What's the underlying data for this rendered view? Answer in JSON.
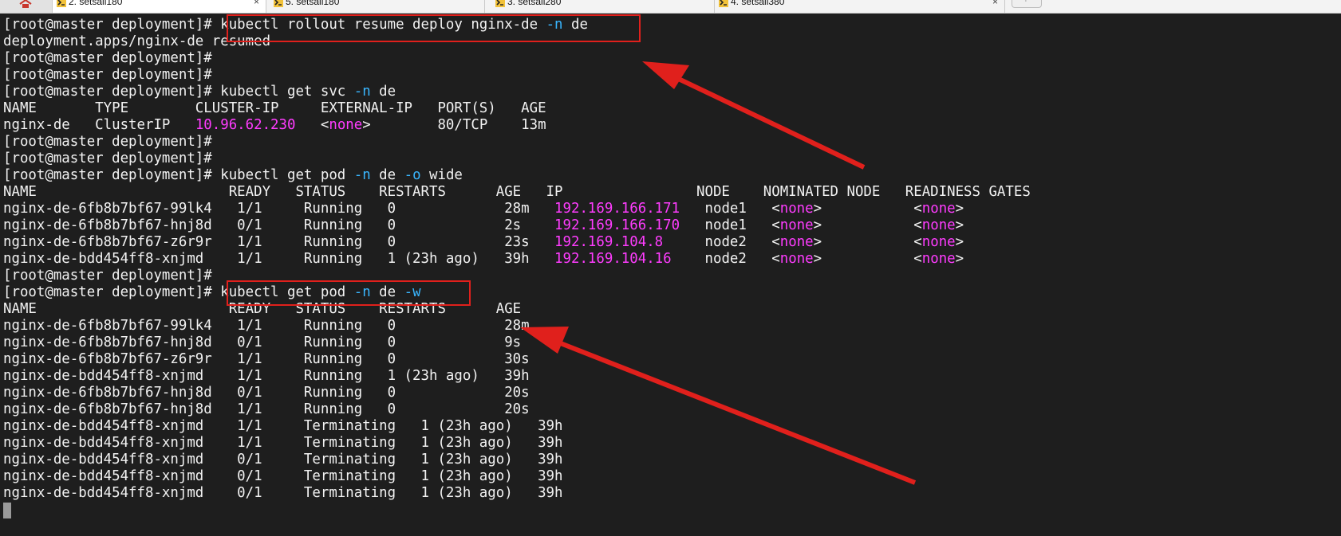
{
  "window": {
    "tabs": [
      {
        "label": "2. setsail180",
        "active": true,
        "has_close": true
      },
      {
        "label": "5. setsail180",
        "active": false,
        "has_close": false
      },
      {
        "label": "3. setsail280",
        "active": false,
        "has_close": false
      },
      {
        "label": "4. setsail380",
        "active": false,
        "has_close": true
      }
    ],
    "new_tab_glyph": "+",
    "close_glyph": "×"
  },
  "terminal": {
    "lines": [
      [
        {
          "t": "[root@master deployment]# kubectl rollout resume deploy nginx-de "
        },
        {
          "t": "-n",
          "c": "flag"
        },
        {
          "t": " de"
        }
      ],
      [
        {
          "t": "deployment.apps/nginx-de resumed"
        }
      ],
      [
        {
          "t": "[root@master deployment]#"
        }
      ],
      [
        {
          "t": "[root@master deployment]#"
        }
      ],
      [
        {
          "t": "[root@master deployment]# kubectl get svc "
        },
        {
          "t": "-n",
          "c": "flag"
        },
        {
          "t": " de"
        }
      ],
      [
        {
          "t": "NAME       TYPE        CLUSTER-IP     EXTERNAL-IP   PORT(S)   AGE"
        }
      ],
      [
        {
          "t": "nginx-de   ClusterIP   "
        },
        {
          "t": "10.96.62.230",
          "c": "ip"
        },
        {
          "t": "   <"
        },
        {
          "t": "none",
          "c": "none"
        },
        {
          "t": ">        80/TCP    13m"
        }
      ],
      [
        {
          "t": "[root@master deployment]#"
        }
      ],
      [
        {
          "t": "[root@master deployment]#"
        }
      ],
      [
        {
          "t": "[root@master deployment]# kubectl get pod "
        },
        {
          "t": "-n",
          "c": "flag"
        },
        {
          "t": " de "
        },
        {
          "t": "-o",
          "c": "flag"
        },
        {
          "t": " wide"
        }
      ],
      [
        {
          "t": "NAME                       READY   STATUS    RESTARTS      AGE   IP                NODE    NOMINATED NODE   READINESS GATES"
        }
      ],
      [
        {
          "t": "nginx-de-6fb8b7bf67-99lk4   1/1     Running   0             28m   "
        },
        {
          "t": "192.169.166.171",
          "c": "ip"
        },
        {
          "t": "   node1   <"
        },
        {
          "t": "none",
          "c": "none"
        },
        {
          "t": ">           <"
        },
        {
          "t": "none",
          "c": "none"
        },
        {
          "t": ">"
        }
      ],
      [
        {
          "t": "nginx-de-6fb8b7bf67-hnj8d   0/1     Running   0             2s    "
        },
        {
          "t": "192.169.166.170",
          "c": "ip"
        },
        {
          "t": "   node1   <"
        },
        {
          "t": "none",
          "c": "none"
        },
        {
          "t": ">           <"
        },
        {
          "t": "none",
          "c": "none"
        },
        {
          "t": ">"
        }
      ],
      [
        {
          "t": "nginx-de-6fb8b7bf67-z6r9r   1/1     Running   0             23s   "
        },
        {
          "t": "192.169.104.8",
          "c": "ip"
        },
        {
          "t": "     node2   <"
        },
        {
          "t": "none",
          "c": "none"
        },
        {
          "t": ">           <"
        },
        {
          "t": "none",
          "c": "none"
        },
        {
          "t": ">"
        }
      ],
      [
        {
          "t": "nginx-de-bdd454ff8-xnjmd    1/1     Running   1 (23h ago)   39h   "
        },
        {
          "t": "192.169.104.16",
          "c": "ip"
        },
        {
          "t": "    node2   <"
        },
        {
          "t": "none",
          "c": "none"
        },
        {
          "t": ">           <"
        },
        {
          "t": "none",
          "c": "none"
        },
        {
          "t": ">"
        }
      ],
      [
        {
          "t": "[root@master deployment]#"
        }
      ],
      [
        {
          "t": "[root@master deployment]# kubectl get pod "
        },
        {
          "t": "-n",
          "c": "flag"
        },
        {
          "t": " de "
        },
        {
          "t": "-w",
          "c": "flag"
        }
      ],
      [
        {
          "t": "NAME                       READY   STATUS    RESTARTS      AGE"
        }
      ],
      [
        {
          "t": "nginx-de-6fb8b7bf67-99lk4   1/1     Running   0             28m"
        }
      ],
      [
        {
          "t": "nginx-de-6fb8b7bf67-hnj8d   0/1     Running   0             9s"
        }
      ],
      [
        {
          "t": "nginx-de-6fb8b7bf67-z6r9r   1/1     Running   0             30s"
        }
      ],
      [
        {
          "t": "nginx-de-bdd454ff8-xnjmd    1/1     Running   1 (23h ago)   39h"
        }
      ],
      [
        {
          "t": "nginx-de-6fb8b7bf67-hnj8d   0/1     Running   0             20s"
        }
      ],
      [
        {
          "t": "nginx-de-6fb8b7bf67-hnj8d   1/1     Running   0             20s"
        }
      ],
      [
        {
          "t": "nginx-de-bdd454ff8-xnjmd    1/1     Terminating   1 (23h ago)   39h"
        }
      ],
      [
        {
          "t": "nginx-de-bdd454ff8-xnjmd    1/1     Terminating   1 (23h ago)   39h"
        }
      ],
      [
        {
          "t": "nginx-de-bdd454ff8-xnjmd    0/1     Terminating   1 (23h ago)   39h"
        }
      ],
      [
        {
          "t": "nginx-de-bdd454ff8-xnjmd    0/1     Terminating   1 (23h ago)   39h"
        }
      ],
      [
        {
          "t": "nginx-de-bdd454ff8-xnjmd    0/1     Terminating   1 (23h ago)   39h"
        }
      ]
    ],
    "colors": {
      "background": "#1e1e1e",
      "text": "#f2f2f2",
      "ip": "#ff3cff",
      "none": "#ff3cff",
      "flag": "#39b6ff",
      "annotation": "#e0201c"
    }
  },
  "annotations": {
    "color": "#e0201c",
    "highlighted_commands": [
      "kubectl rollout resume deploy nginx-de -n de",
      "kubectl get pod -n de -w"
    ]
  }
}
